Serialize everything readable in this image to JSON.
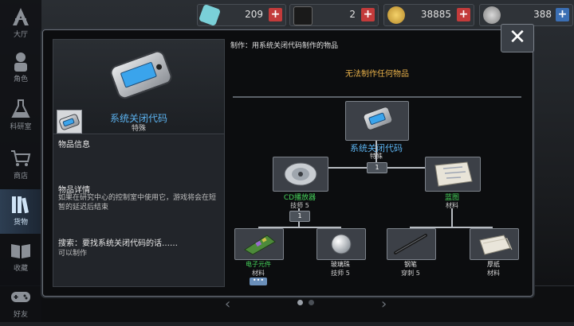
{
  "nav": {
    "items": [
      {
        "label": "大厅",
        "icon": "lobby-icon"
      },
      {
        "label": "角色",
        "icon": "character-icon"
      },
      {
        "label": "科研室",
        "icon": "lab-flask-icon"
      },
      {
        "label": "商店",
        "icon": "cart-icon"
      },
      {
        "label": "货物",
        "icon": "books-icon",
        "active": true
      },
      {
        "label": "收藏",
        "icon": "collection-book-icon"
      },
      {
        "label": "好友",
        "icon": "gamepad-icon"
      }
    ]
  },
  "resources": [
    {
      "value": "209",
      "icon": "gem-icon"
    },
    {
      "value": "2",
      "icon": "card-icon"
    },
    {
      "value": "38885",
      "icon": "coin-icon"
    },
    {
      "value": "388",
      "icon": "token-icon"
    }
  ],
  "dialog": {
    "craft_title": "制作：用系统关闭代码制作的物品",
    "warning": "无法制作任何物品",
    "close_label": "✕"
  },
  "detail": {
    "name": "系统关闭代码",
    "rarity": "特殊",
    "info_header": "物品信息",
    "desc_header": "物品详情",
    "description": "如果在研究中心的控制室中使用它，游戏将会在短暂的延迟后结束",
    "search_header": "搜索：要找系统关闭代码的话……",
    "search_text": "可以制作"
  },
  "tree": {
    "root": {
      "name": "系统关闭代码",
      "sub": "特殊",
      "count": "1"
    },
    "left": {
      "name": "CD播放器",
      "sub": "技师 5",
      "count": "1"
    },
    "right": {
      "name": "蓝图",
      "sub": "材料"
    },
    "leaves": [
      {
        "name": "电子元件",
        "sub": "材料",
        "extra": "•••"
      },
      {
        "name": "玻璃珠",
        "sub": "技师 5"
      },
      {
        "name": "钢笔",
        "sub": "穿刺 5"
      },
      {
        "name": "厚纸",
        "sub": "材料"
      }
    ]
  },
  "colors": {
    "accent_blue": "#5cb3f0",
    "accent_green": "#45d15a",
    "warning": "#e8b14a",
    "plus_red": "#c33b3b"
  }
}
